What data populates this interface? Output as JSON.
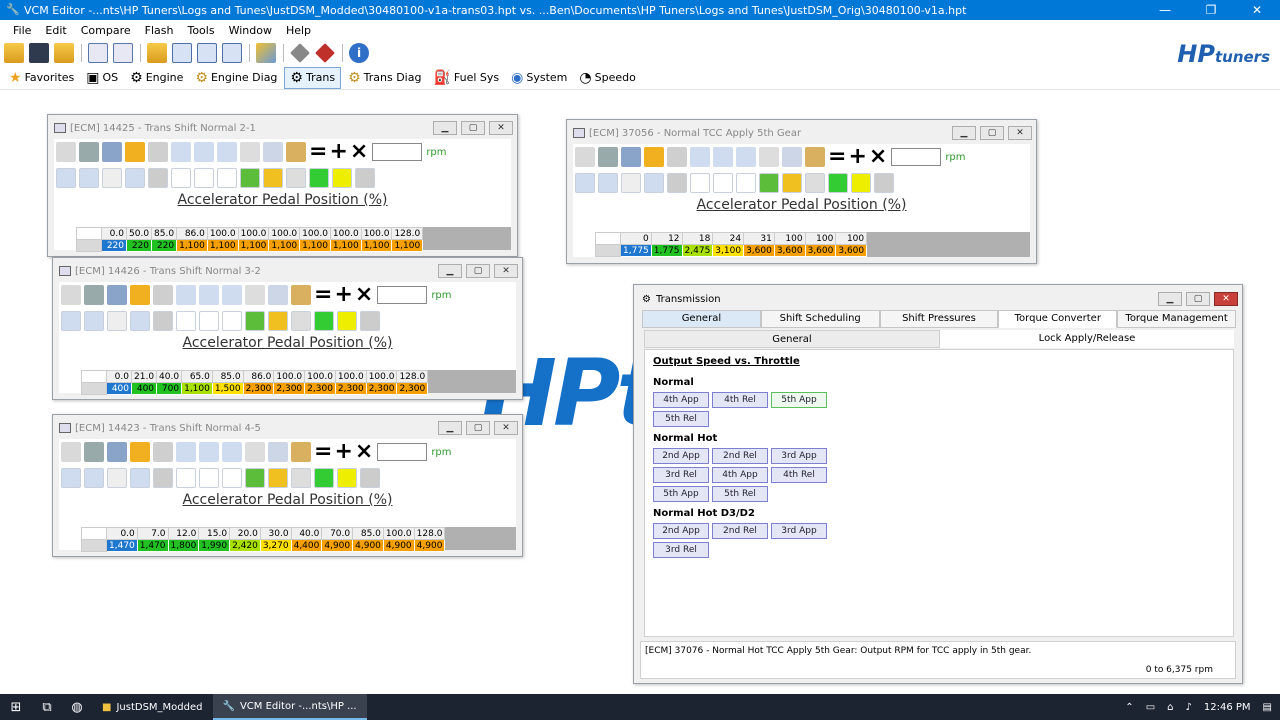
{
  "window": {
    "title": "VCM Editor -...nts\\HP Tuners\\Logs and Tunes\\JustDSM_Modded\\30480100-v1a-trans03.hpt vs. ...Ben\\Documents\\HP Tuners\\Logs and Tunes\\JustDSM_Orig\\30480100-v1a.hpt",
    "minimize": "—",
    "maximize": "❐",
    "close": "✕"
  },
  "menu": [
    "File",
    "Edit",
    "Compare",
    "Flash",
    "Tools",
    "Window",
    "Help"
  ],
  "logo": {
    "hp": "HP",
    "tuners": "tuners"
  },
  "categories": [
    {
      "label": "Favorites",
      "icon": "star-icon"
    },
    {
      "label": "OS",
      "icon": "chip-icon"
    },
    {
      "label": "Engine",
      "icon": "engine-icon"
    },
    {
      "label": "Engine Diag",
      "icon": "engine-diag-icon"
    },
    {
      "label": "Trans",
      "icon": "gear-icon",
      "active": true
    },
    {
      "label": "Trans Diag",
      "icon": "trans-diag-icon"
    },
    {
      "label": "Fuel Sys",
      "icon": "fuel-icon"
    },
    {
      "label": "System",
      "icon": "system-icon"
    },
    {
      "label": "Speedo",
      "icon": "speedo-icon"
    }
  ],
  "bg_logo": "HPt",
  "tables": [
    {
      "title": "[ECM] 14425 - Trans Shift Normal 2-1",
      "unit": "rpm",
      "axis": "Accelerator Pedal Position (%)",
      "headers": [
        "0.0",
        "50.0",
        "85.0",
        "86.0",
        "100.0",
        "100.0",
        "100.0",
        "100.0",
        "100.0",
        "100.0",
        "128.0"
      ],
      "values": [
        "220",
        "220",
        "220",
        "1,100",
        "1,100",
        "1,100",
        "1,100",
        "1,100",
        "1,100",
        "1,100",
        "1,100"
      ],
      "colors": [
        "#1f77d0",
        "#22c122",
        "#22c122",
        "#f5a000",
        "#f5a000",
        "#f5a000",
        "#f5a000",
        "#f5a000",
        "#f5a000",
        "#f5a000",
        "#f5a000"
      ]
    },
    {
      "title": "[ECM] 37056 - Normal TCC Apply 5th Gear",
      "unit": "rpm",
      "axis": "Accelerator Pedal Position (%)",
      "headers": [
        "0",
        "12",
        "18",
        "24",
        "31",
        "100",
        "100",
        "100"
      ],
      "values": [
        "1,775",
        "1,775",
        "2,475",
        "3,100",
        "3,600",
        "3,600",
        "3,600",
        "3,600"
      ],
      "colors": [
        "#1f77d0",
        "#22c122",
        "#a8e000",
        "#ffe000",
        "#f5a000",
        "#f5a000",
        "#f5a000",
        "#f5a000"
      ]
    },
    {
      "title": "[ECM] 14426 - Trans Shift Normal 3-2",
      "unit": "rpm",
      "axis": "Accelerator Pedal Position (%)",
      "headers": [
        "0.0",
        "21.0",
        "40.0",
        "65.0",
        "85.0",
        "86.0",
        "100.0",
        "100.0",
        "100.0",
        "100.0",
        "128.0"
      ],
      "values": [
        "400",
        "400",
        "700",
        "1,100",
        "1,500",
        "2,300",
        "2,300",
        "2,300",
        "2,300",
        "2,300",
        "2,300"
      ],
      "colors": [
        "#1f77d0",
        "#22c122",
        "#22c122",
        "#a8e000",
        "#ffe000",
        "#f5a000",
        "#f5a000",
        "#f5a000",
        "#f5a000",
        "#f5a000",
        "#f5a000"
      ]
    },
    {
      "title": "[ECM] 14423 - Trans Shift Normal 4-5",
      "unit": "rpm",
      "axis": "Accelerator Pedal Position (%)",
      "headers": [
        "0.0",
        "7.0",
        "12.0",
        "15.0",
        "20.0",
        "30.0",
        "40.0",
        "70.0",
        "85.0",
        "100.0",
        "128.0"
      ],
      "values": [
        "1,470",
        "1,470",
        "1,800",
        "1,990",
        "2,420",
        "3,270",
        "4,400",
        "4,900",
        "4,900",
        "4,900",
        "4,900"
      ],
      "colors": [
        "#1f77d0",
        "#22c122",
        "#22c122",
        "#22c122",
        "#a8e000",
        "#ffe000",
        "#f5a000",
        "#f5a000",
        "#f5a000",
        "#f5a000",
        "#f5a000"
      ]
    }
  ],
  "transmission": {
    "title": "Transmission",
    "tabs": [
      "General",
      "Shift Scheduling",
      "Shift Pressures",
      "Torque Converter",
      "Torque Management"
    ],
    "subtabs": [
      "General",
      "Lock Apply/Release"
    ],
    "heading": "Output Speed vs. Throttle",
    "sections": [
      {
        "title": "Normal",
        "rows": [
          [
            "4th App",
            "4th Rel",
            "5th App"
          ],
          [
            "5th Rel"
          ]
        ]
      },
      {
        "title": "Normal Hot",
        "rows": [
          [
            "2nd App",
            "2nd Rel",
            "3rd App"
          ],
          [
            "3rd Rel",
            "4th App",
            "4th Rel"
          ],
          [
            "5th App",
            "5th Rel"
          ]
        ]
      },
      {
        "title": "Normal Hot D3/D2",
        "rows": [
          [
            "2nd App",
            "2nd Rel",
            "3rd App"
          ],
          [
            "3rd Rel"
          ]
        ]
      }
    ],
    "description": "[ECM] 37076 - Normal Hot TCC Apply 5th Gear: Output RPM for TCC apply in 5th gear.",
    "range": "0 to 6,375 rpm"
  },
  "taskbar": {
    "apps": [
      {
        "label": "JustDSM_Modded",
        "icon": "folder-icon"
      },
      {
        "label": "VCM Editor -...nts\\HP ...",
        "icon": "vcm-icon",
        "active": true
      }
    ],
    "time": "12:46 PM"
  }
}
